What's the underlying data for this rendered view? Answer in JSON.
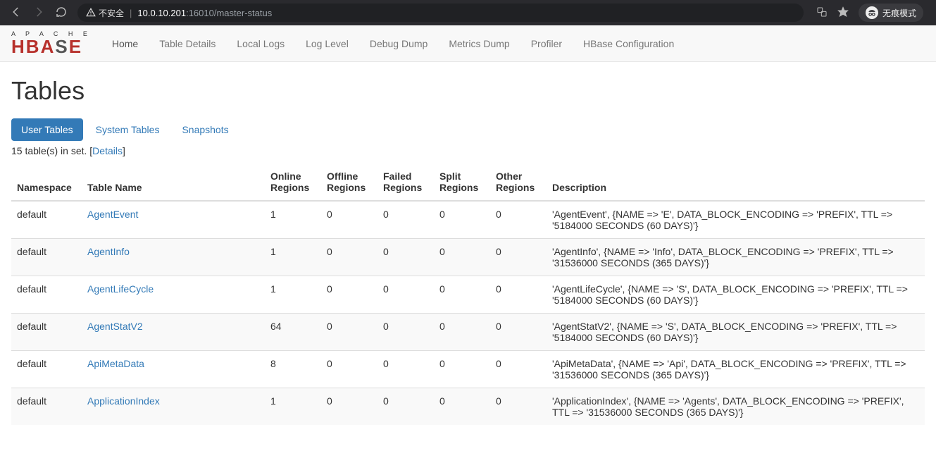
{
  "browser": {
    "insecure_label": "不安全",
    "url_host": "10.0.10.201",
    "url_port_path": ":16010/master-status",
    "incognito_label": "无痕模式"
  },
  "nav": {
    "brand_top": "A P A C H E",
    "brand_main": "HBASE",
    "items": [
      "Home",
      "Table Details",
      "Local Logs",
      "Log Level",
      "Debug Dump",
      "Metrics Dump",
      "Profiler",
      "HBase Configuration"
    ],
    "active": "Home"
  },
  "page": {
    "title": "Tables",
    "tabs": [
      "User Tables",
      "System Tables",
      "Snapshots"
    ],
    "active_tab": "User Tables",
    "set_summary_prefix": "15 table(s) in set. [",
    "set_summary_link": "Details",
    "set_summary_suffix": "]"
  },
  "columns": [
    "Namespace",
    "Table Name",
    "Online Regions",
    "Offline Regions",
    "Failed Regions",
    "Split Regions",
    "Other Regions",
    "Description"
  ],
  "rows": [
    {
      "ns": "default",
      "name": "AgentEvent",
      "online": "1",
      "offline": "0",
      "failed": "0",
      "split": "0",
      "other": "0",
      "desc": "'AgentEvent', {NAME => 'E', DATA_BLOCK_ENCODING => 'PREFIX', TTL => '5184000 SECONDS (60 DAYS)'}"
    },
    {
      "ns": "default",
      "name": "AgentInfo",
      "online": "1",
      "offline": "0",
      "failed": "0",
      "split": "0",
      "other": "0",
      "desc": "'AgentInfo', {NAME => 'Info', DATA_BLOCK_ENCODING => 'PREFIX', TTL => '31536000 SECONDS (365 DAYS)'}"
    },
    {
      "ns": "default",
      "name": "AgentLifeCycle",
      "online": "1",
      "offline": "0",
      "failed": "0",
      "split": "0",
      "other": "0",
      "desc": "'AgentLifeCycle', {NAME => 'S', DATA_BLOCK_ENCODING => 'PREFIX', TTL => '5184000 SECONDS (60 DAYS)'}"
    },
    {
      "ns": "default",
      "name": "AgentStatV2",
      "online": "64",
      "offline": "0",
      "failed": "0",
      "split": "0",
      "other": "0",
      "desc": "'AgentStatV2', {NAME => 'S', DATA_BLOCK_ENCODING => 'PREFIX', TTL => '5184000 SECONDS (60 DAYS)'}"
    },
    {
      "ns": "default",
      "name": "ApiMetaData",
      "online": "8",
      "offline": "0",
      "failed": "0",
      "split": "0",
      "other": "0",
      "desc": "'ApiMetaData', {NAME => 'Api', DATA_BLOCK_ENCODING => 'PREFIX', TTL => '31536000 SECONDS (365 DAYS)'}"
    },
    {
      "ns": "default",
      "name": "ApplicationIndex",
      "online": "1",
      "offline": "0",
      "failed": "0",
      "split": "0",
      "other": "0",
      "desc": "'ApplicationIndex', {NAME => 'Agents', DATA_BLOCK_ENCODING => 'PREFIX', TTL => '31536000 SECONDS (365 DAYS)'}"
    }
  ]
}
